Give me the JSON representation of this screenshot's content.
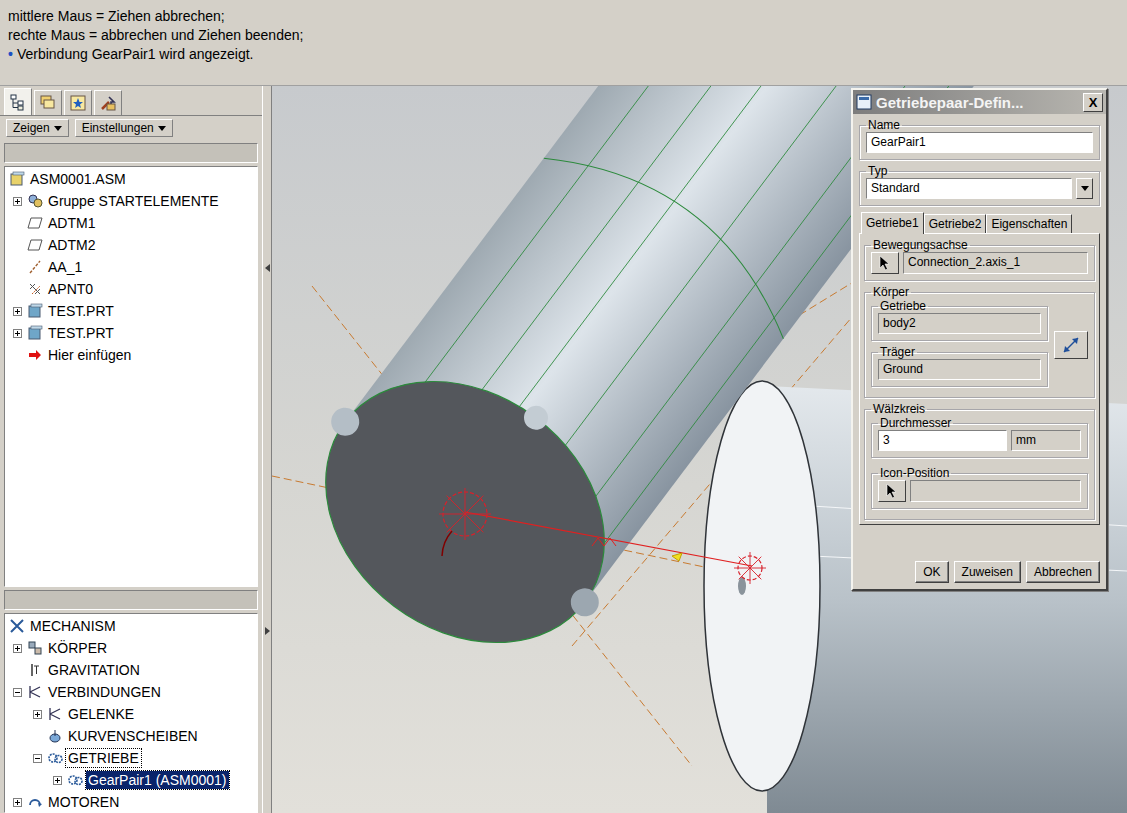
{
  "message_area": {
    "lines": [
      {
        "text": "mittlere Maus = Ziehen abbrechen;"
      },
      {
        "text": "rechte Maus = abbrechen und Ziehen beenden;"
      },
      {
        "text": "Verbindung GearPair1 wird angezeigt.",
        "bullet": "•"
      }
    ]
  },
  "model_tree": {
    "tabs": [
      {
        "selected": true
      },
      {
        "selected": false
      },
      {
        "selected": false
      },
      {
        "selected": false
      }
    ],
    "buttons": [
      {
        "label": "Zeigen"
      },
      {
        "label": "Einstellungen"
      }
    ],
    "items": [
      {
        "label": "ASM0001.ASM",
        "level": 0,
        "kind": "assembly",
        "has_children": false,
        "expanded": false
      },
      {
        "label": "Gruppe STARTELEMENTE",
        "level": 1,
        "kind": "group",
        "has_children": true,
        "expanded": false
      },
      {
        "label": "ADTM1",
        "level": 1,
        "kind": "plane",
        "has_children": false,
        "expanded": false
      },
      {
        "label": "ADTM2",
        "level": 1,
        "kind": "plane",
        "has_children": false,
        "expanded": false
      },
      {
        "label": "AA_1",
        "level": 1,
        "kind": "axis",
        "has_children": false,
        "expanded": false
      },
      {
        "label": "APNT0",
        "level": 1,
        "kind": "point",
        "has_children": false,
        "expanded": false
      },
      {
        "label": "TEST.PRT",
        "level": 1,
        "kind": "part",
        "has_children": true,
        "expanded": false
      },
      {
        "label": "TEST.PRT",
        "level": 1,
        "kind": "part",
        "has_children": true,
        "expanded": false
      },
      {
        "label": "Hier einfügen",
        "level": 1,
        "kind": "insert",
        "has_children": false,
        "expanded": false
      }
    ]
  },
  "mechanism_tree": {
    "items": [
      {
        "label": "MECHANISM",
        "level": 0,
        "kind": "mechanism",
        "has_children": false,
        "expanded": true,
        "selected": false,
        "focused": false
      },
      {
        "label": "KÖRPER",
        "level": 1,
        "kind": "bodies",
        "has_children": true,
        "expanded": false,
        "selected": false,
        "focused": false
      },
      {
        "label": "GRAVITATION",
        "level": 1,
        "kind": "gravity",
        "has_children": false,
        "expanded": false,
        "selected": false,
        "focused": false
      },
      {
        "label": "VERBINDUNGEN",
        "level": 1,
        "kind": "connections",
        "has_children": true,
        "expanded": true,
        "selected": false,
        "focused": false
      },
      {
        "label": "GELENKE",
        "level": 2,
        "kind": "joints",
        "has_children": true,
        "expanded": false,
        "selected": false,
        "focused": false
      },
      {
        "label": "KURVENSCHEIBEN",
        "level": 2,
        "kind": "cams",
        "has_children": false,
        "expanded": false,
        "selected": false,
        "focused": false
      },
      {
        "label": "GETRIEBE",
        "level": 2,
        "kind": "gears",
        "has_children": true,
        "expanded": true,
        "selected": false,
        "focused": true
      },
      {
        "label": "GearPair1 (ASM0001)",
        "level": 3,
        "kind": "gear",
        "has_children": true,
        "expanded": false,
        "selected": true,
        "focused": false
      },
      {
        "label": "MOTOREN",
        "level": 1,
        "kind": "motors",
        "has_children": true,
        "expanded": false,
        "selected": false,
        "focused": false
      }
    ]
  },
  "dialog": {
    "title": "Getriebepaar-Defin...",
    "close": "X",
    "name": {
      "label": "Name",
      "value": "GearPair1",
      "readonly": false
    },
    "type": {
      "label": "Typ",
      "value": "Standard"
    },
    "tabs": [
      {
        "label": "Getriebe1",
        "selected": true
      },
      {
        "label": "Getriebe2",
        "selected": false
      },
      {
        "label": "Eigenschaften",
        "selected": false
      }
    ],
    "motion_axis": {
      "label": "Bewegungsachse",
      "value": "Connection_2.axis_1",
      "readonly": true
    },
    "bodies": {
      "label": "Körper",
      "gear": {
        "label": "Getriebe",
        "value": "body2",
        "readonly": true
      },
      "carrier": {
        "label": "Träger",
        "value": "Ground",
        "readonly": true
      }
    },
    "pitch_circle": {
      "label": "Wälzkreis",
      "diameter": {
        "label": "Durchmesser",
        "value": "3",
        "unit": "mm",
        "readonly": false
      },
      "icon_position": {
        "label": "Icon-Position",
        "value": "",
        "readonly": true
      }
    },
    "buttons": [
      {
        "label": "OK"
      },
      {
        "label": "Zuweisen"
      },
      {
        "label": "Abbrechen"
      }
    ]
  }
}
